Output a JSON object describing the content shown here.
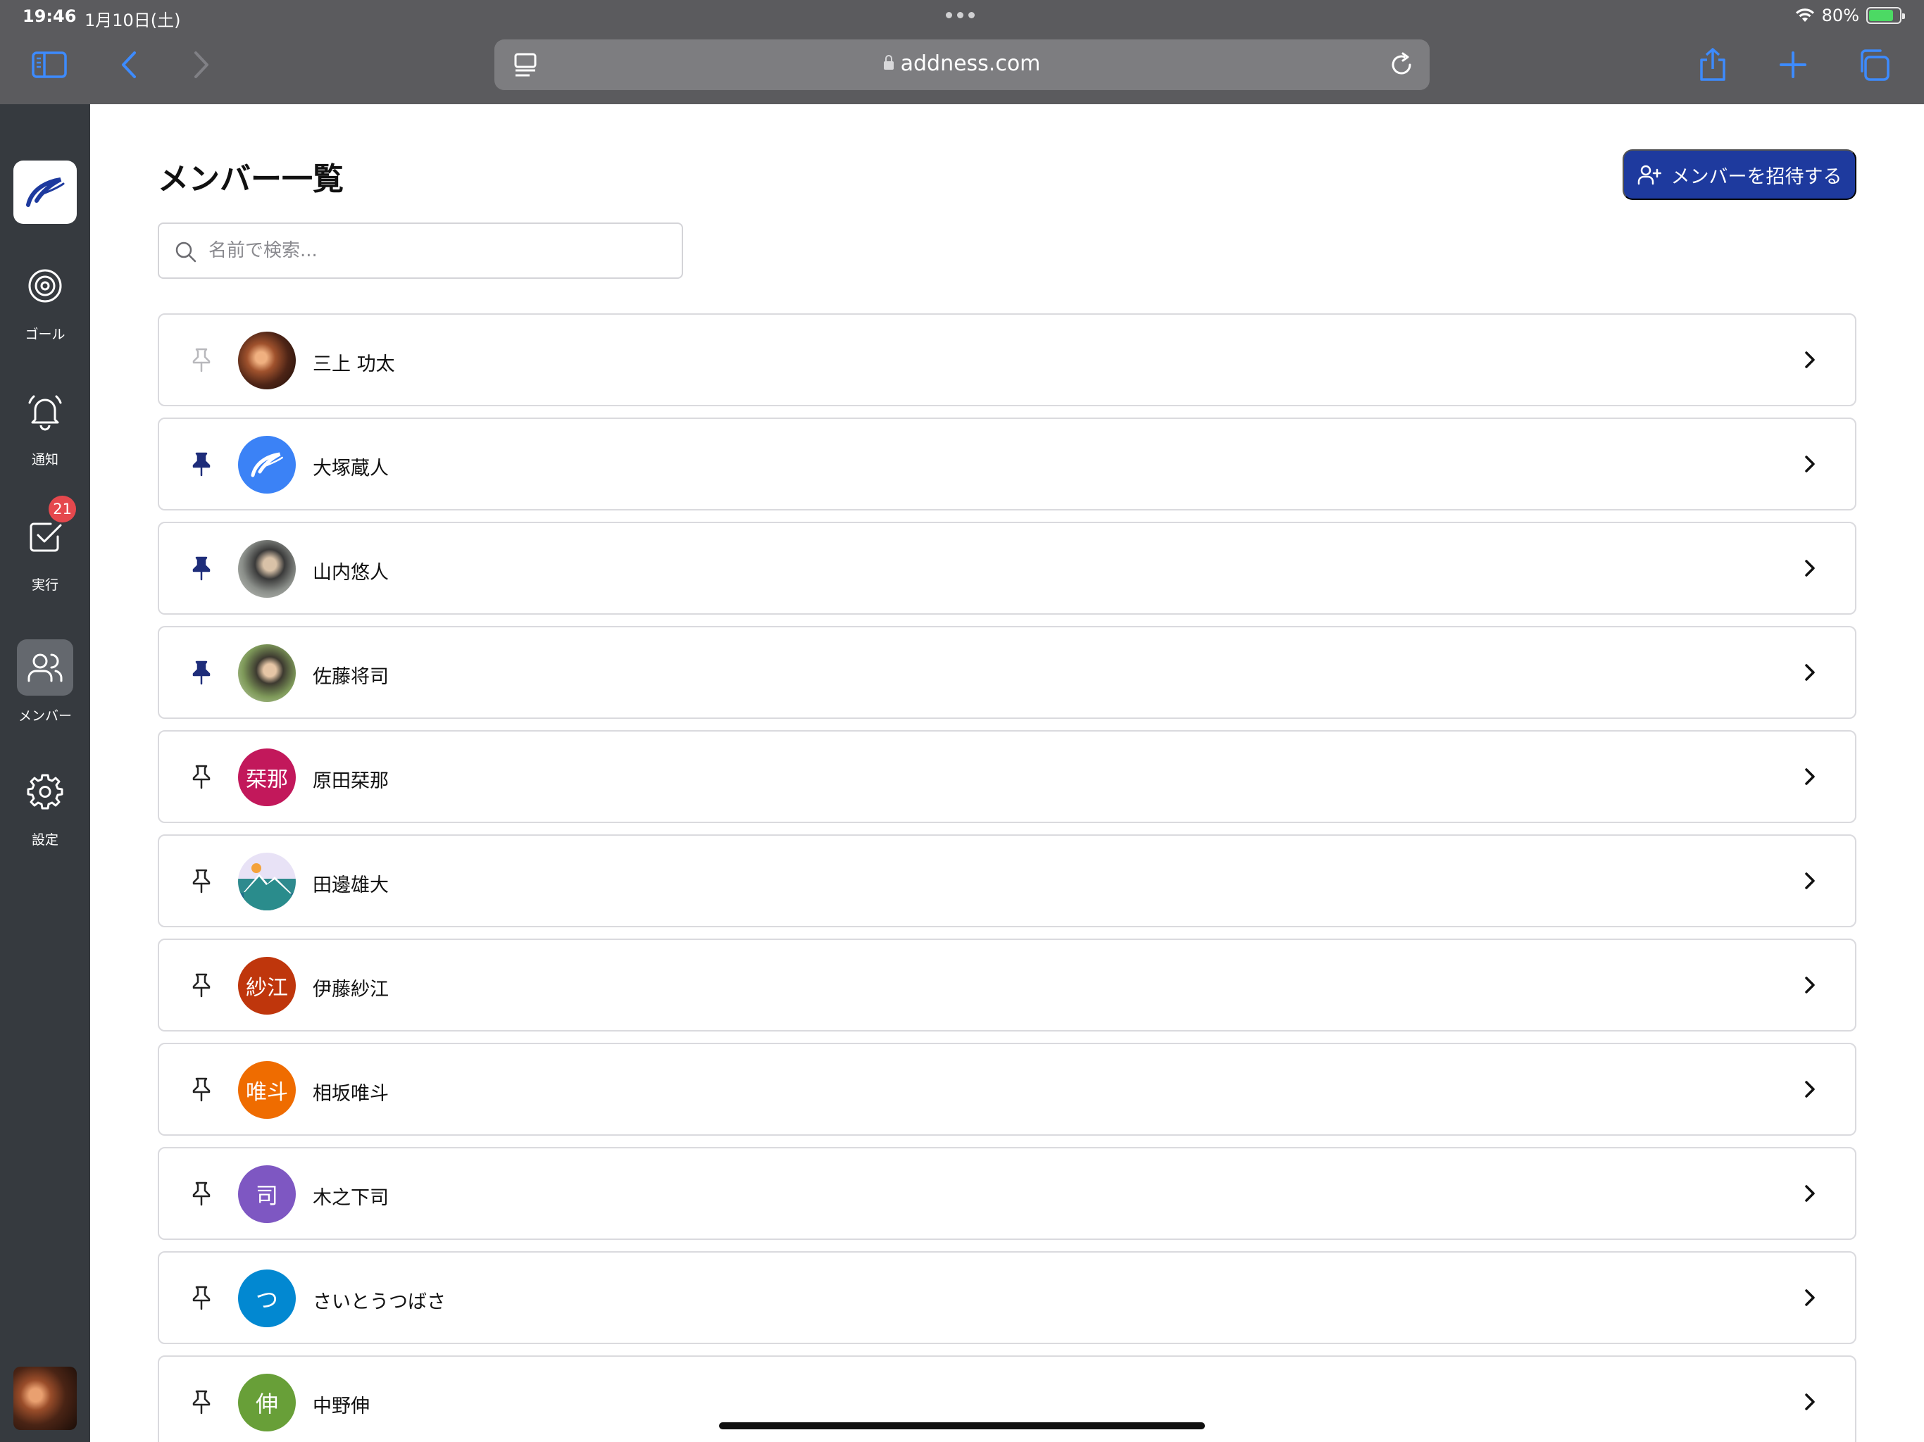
{
  "status_bar": {
    "time": "19:46",
    "date": "1月10日(土)",
    "battery": "80%",
    "battery_level": 0.8
  },
  "browser": {
    "url": "addness.com"
  },
  "sidebar": {
    "items": [
      {
        "label": "ゴール",
        "icon": "target-icon"
      },
      {
        "label": "通知",
        "icon": "bell-icon"
      },
      {
        "label": "実行",
        "icon": "checkbox-icon",
        "badge": "21"
      },
      {
        "label": "メンバー",
        "icon": "users-icon",
        "active": true
      },
      {
        "label": "設定",
        "icon": "gear-icon"
      }
    ]
  },
  "main": {
    "title": "メンバー一覧",
    "invite_label": "メンバーを招待する",
    "search_placeholder": "名前で検索..."
  },
  "members": [
    {
      "name": "三上 功太",
      "pinned": false,
      "pin_faint": true,
      "avatar_text": "",
      "avatar_kind": "photo-warm"
    },
    {
      "name": "大塚蔵人",
      "pinned": true,
      "avatar_text": "",
      "avatar_kind": "logo",
      "avatar_color": "#3b82f6"
    },
    {
      "name": "山内悠人",
      "pinned": true,
      "avatar_text": "",
      "avatar_kind": "photo-gray"
    },
    {
      "name": "佐藤将司",
      "pinned": true,
      "avatar_text": "",
      "avatar_kind": "photo-green"
    },
    {
      "name": "原田栞那",
      "pinned": false,
      "avatar_text": "栞那",
      "avatar_color": "#c2185b"
    },
    {
      "name": "田邊雄大",
      "pinned": false,
      "avatar_text": "",
      "avatar_kind": "illustration"
    },
    {
      "name": "伊藤紗江",
      "pinned": false,
      "avatar_text": "紗江",
      "avatar_color": "#bf360c"
    },
    {
      "name": "相坂唯斗",
      "pinned": false,
      "avatar_text": "唯斗",
      "avatar_color": "#ef6c00"
    },
    {
      "name": "木之下司",
      "pinned": false,
      "avatar_text": "司",
      "avatar_color": "#7e57c2"
    },
    {
      "name": "さいとうつばさ",
      "pinned": false,
      "avatar_text": "つ",
      "avatar_color": "#0288d1"
    },
    {
      "name": "中野伸",
      "pinned": false,
      "avatar_text": "伸",
      "avatar_color": "#689f38"
    }
  ]
}
